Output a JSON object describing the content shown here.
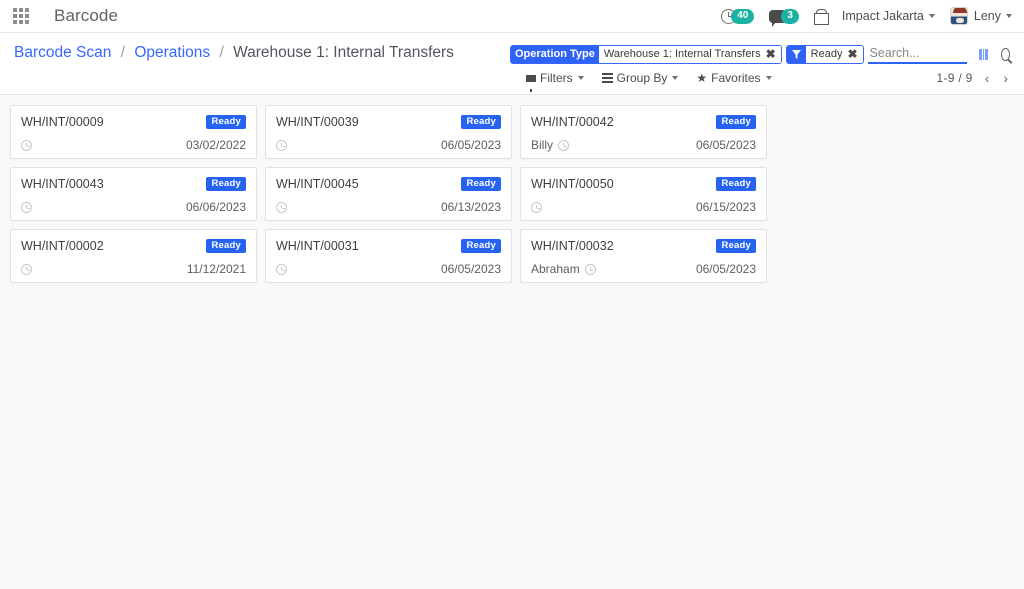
{
  "navbar": {
    "apps_icon": "apps-grid-icon",
    "brand": "Barcode",
    "activities": {
      "icon": "clock-icon",
      "count": "40"
    },
    "messages": {
      "icon": "chat-icon",
      "count": "3"
    },
    "gift": {
      "icon": "gift-icon"
    },
    "company": "Impact Jakarta",
    "user": "Leny",
    "accent_teal": "#1ab2a2"
  },
  "breadcrumb": {
    "root": "Barcode Scan",
    "parent": "Operations",
    "current": "Warehouse 1: Internal Transfers",
    "separator": "/"
  },
  "search": {
    "placeholder": "Search...",
    "value": "",
    "barcode_icon": "barcode-icon",
    "search_icon": "search-icon",
    "facets": [
      {
        "label": "Operation Type",
        "value": "Warehouse 1: Internal Transfers",
        "remove": "✖",
        "icon": ""
      },
      {
        "label": "",
        "value": "Ready",
        "remove": "✖",
        "icon": "filter-icon"
      }
    ]
  },
  "toolbar": {
    "filters": "Filters",
    "group_by": "Group By",
    "favorites": "Favorites",
    "caret": "▾",
    "pager": "1-9 / 9",
    "prev": "‹",
    "next": "›"
  },
  "kanban": {
    "badge_color": "#2563f0",
    "cards": [
      {
        "name": "WH/INT/00009",
        "state": "Ready",
        "partner": "",
        "date": "03/02/2022"
      },
      {
        "name": "WH/INT/00039",
        "state": "Ready",
        "partner": "",
        "date": "06/05/2023"
      },
      {
        "name": "WH/INT/00042",
        "state": "Ready",
        "partner": "Billy",
        "date": "06/05/2023"
      },
      {
        "name": "WH/INT/00043",
        "state": "Ready",
        "partner": "",
        "date": "06/06/2023"
      },
      {
        "name": "WH/INT/00045",
        "state": "Ready",
        "partner": "",
        "date": "06/13/2023"
      },
      {
        "name": "WH/INT/00050",
        "state": "Ready",
        "partner": "",
        "date": "06/15/2023"
      },
      {
        "name": "WH/INT/00002",
        "state": "Ready",
        "partner": "",
        "date": "11/12/2021"
      },
      {
        "name": "WH/INT/00031",
        "state": "Ready",
        "partner": "",
        "date": "06/05/2023"
      },
      {
        "name": "WH/INT/00032",
        "state": "Ready",
        "partner": "Abraham",
        "date": "06/05/2023"
      }
    ]
  }
}
